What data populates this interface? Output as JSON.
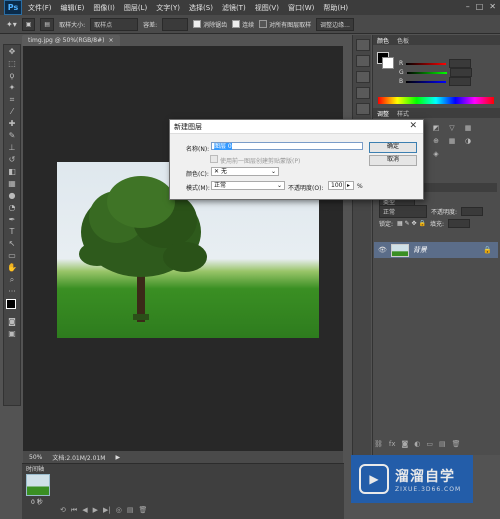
{
  "menubar": {
    "logo": "Ps",
    "items": [
      "文件(F)",
      "编辑(E)",
      "图像(I)",
      "图层(L)",
      "文字(Y)",
      "选择(S)",
      "滤镜(T)",
      "视图(V)",
      "窗口(W)",
      "帮助(H)"
    ]
  },
  "options": {
    "sample_size": "取样大小:",
    "sample_value": "取样点",
    "tolerance_label": "容差:",
    "antialias": "消除锯齿",
    "contiguous": "连续",
    "all_layers": "对所有图层取样",
    "refine_edge": "调整边缘..."
  },
  "document": {
    "tab_title": "timg.jpg @ 50%(RGB/8#)",
    "zoom": "50%",
    "doc_size": "文档:2.01M/2.01M"
  },
  "timeline": {
    "title": "时间轴",
    "frame_time": "0 秒"
  },
  "panels": {
    "color_tabs": [
      "颜色",
      "色板"
    ],
    "adjust_tabs": [
      "调整",
      "样式"
    ],
    "layers": {
      "blend_mode": "正常",
      "opacity_label": "不透明度:",
      "lock_label": "锁定:",
      "fill_label": "填充:",
      "layer_name": "背景"
    }
  },
  "dialog": {
    "title": "新建图层",
    "name_label": "名称(N):",
    "name_value": "图层 0",
    "clip_checkbox": "使用前一图层创建剪贴蒙版(P)",
    "color_label": "颜色(C):",
    "color_value": "无",
    "mode_label": "模式(M):",
    "mode_value": "正常",
    "opacity_label": "不透明度(O):",
    "opacity_value": "100",
    "opacity_unit": "%",
    "ok_button": "确定",
    "cancel_button": "取消"
  },
  "watermark": {
    "brand": "溜溜自学",
    "url": "ZIXUE.3D66.COM"
  },
  "colors": {
    "dialog_bg": "#f0f0f0",
    "layer_selected": "#5b6d89",
    "watermark_blue": "#1d5fb5"
  }
}
